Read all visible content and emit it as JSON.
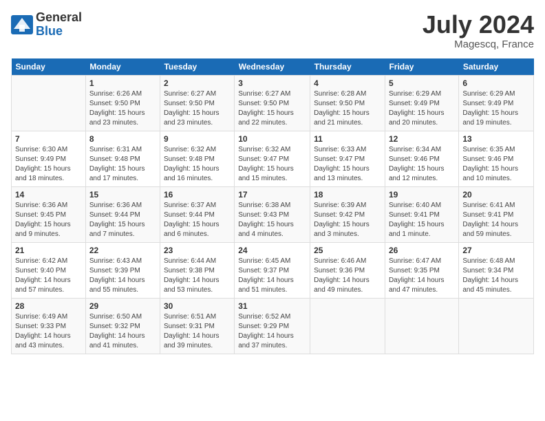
{
  "logo": {
    "general": "General",
    "blue": "Blue"
  },
  "title": "July 2024",
  "location": "Magescq, France",
  "days_header": [
    "Sunday",
    "Monday",
    "Tuesday",
    "Wednesday",
    "Thursday",
    "Friday",
    "Saturday"
  ],
  "weeks": [
    [
      {
        "day": "",
        "sunrise": "",
        "sunset": "",
        "daylight": ""
      },
      {
        "day": "1",
        "sunrise": "Sunrise: 6:26 AM",
        "sunset": "Sunset: 9:50 PM",
        "daylight": "Daylight: 15 hours and 23 minutes."
      },
      {
        "day": "2",
        "sunrise": "Sunrise: 6:27 AM",
        "sunset": "Sunset: 9:50 PM",
        "daylight": "Daylight: 15 hours and 23 minutes."
      },
      {
        "day": "3",
        "sunrise": "Sunrise: 6:27 AM",
        "sunset": "Sunset: 9:50 PM",
        "daylight": "Daylight: 15 hours and 22 minutes."
      },
      {
        "day": "4",
        "sunrise": "Sunrise: 6:28 AM",
        "sunset": "Sunset: 9:50 PM",
        "daylight": "Daylight: 15 hours and 21 minutes."
      },
      {
        "day": "5",
        "sunrise": "Sunrise: 6:29 AM",
        "sunset": "Sunset: 9:49 PM",
        "daylight": "Daylight: 15 hours and 20 minutes."
      },
      {
        "day": "6",
        "sunrise": "Sunrise: 6:29 AM",
        "sunset": "Sunset: 9:49 PM",
        "daylight": "Daylight: 15 hours and 19 minutes."
      }
    ],
    [
      {
        "day": "7",
        "sunrise": "Sunrise: 6:30 AM",
        "sunset": "Sunset: 9:49 PM",
        "daylight": "Daylight: 15 hours and 18 minutes."
      },
      {
        "day": "8",
        "sunrise": "Sunrise: 6:31 AM",
        "sunset": "Sunset: 9:48 PM",
        "daylight": "Daylight: 15 hours and 17 minutes."
      },
      {
        "day": "9",
        "sunrise": "Sunrise: 6:32 AM",
        "sunset": "Sunset: 9:48 PM",
        "daylight": "Daylight: 15 hours and 16 minutes."
      },
      {
        "day": "10",
        "sunrise": "Sunrise: 6:32 AM",
        "sunset": "Sunset: 9:47 PM",
        "daylight": "Daylight: 15 hours and 15 minutes."
      },
      {
        "day": "11",
        "sunrise": "Sunrise: 6:33 AM",
        "sunset": "Sunset: 9:47 PM",
        "daylight": "Daylight: 15 hours and 13 minutes."
      },
      {
        "day": "12",
        "sunrise": "Sunrise: 6:34 AM",
        "sunset": "Sunset: 9:46 PM",
        "daylight": "Daylight: 15 hours and 12 minutes."
      },
      {
        "day": "13",
        "sunrise": "Sunrise: 6:35 AM",
        "sunset": "Sunset: 9:46 PM",
        "daylight": "Daylight: 15 hours and 10 minutes."
      }
    ],
    [
      {
        "day": "14",
        "sunrise": "Sunrise: 6:36 AM",
        "sunset": "Sunset: 9:45 PM",
        "daylight": "Daylight: 15 hours and 9 minutes."
      },
      {
        "day": "15",
        "sunrise": "Sunrise: 6:36 AM",
        "sunset": "Sunset: 9:44 PM",
        "daylight": "Daylight: 15 hours and 7 minutes."
      },
      {
        "day": "16",
        "sunrise": "Sunrise: 6:37 AM",
        "sunset": "Sunset: 9:44 PM",
        "daylight": "Daylight: 15 hours and 6 minutes."
      },
      {
        "day": "17",
        "sunrise": "Sunrise: 6:38 AM",
        "sunset": "Sunset: 9:43 PM",
        "daylight": "Daylight: 15 hours and 4 minutes."
      },
      {
        "day": "18",
        "sunrise": "Sunrise: 6:39 AM",
        "sunset": "Sunset: 9:42 PM",
        "daylight": "Daylight: 15 hours and 3 minutes."
      },
      {
        "day": "19",
        "sunrise": "Sunrise: 6:40 AM",
        "sunset": "Sunset: 9:41 PM",
        "daylight": "Daylight: 15 hours and 1 minute."
      },
      {
        "day": "20",
        "sunrise": "Sunrise: 6:41 AM",
        "sunset": "Sunset: 9:41 PM",
        "daylight": "Daylight: 14 hours and 59 minutes."
      }
    ],
    [
      {
        "day": "21",
        "sunrise": "Sunrise: 6:42 AM",
        "sunset": "Sunset: 9:40 PM",
        "daylight": "Daylight: 14 hours and 57 minutes."
      },
      {
        "day": "22",
        "sunrise": "Sunrise: 6:43 AM",
        "sunset": "Sunset: 9:39 PM",
        "daylight": "Daylight: 14 hours and 55 minutes."
      },
      {
        "day": "23",
        "sunrise": "Sunrise: 6:44 AM",
        "sunset": "Sunset: 9:38 PM",
        "daylight": "Daylight: 14 hours and 53 minutes."
      },
      {
        "day": "24",
        "sunrise": "Sunrise: 6:45 AM",
        "sunset": "Sunset: 9:37 PM",
        "daylight": "Daylight: 14 hours and 51 minutes."
      },
      {
        "day": "25",
        "sunrise": "Sunrise: 6:46 AM",
        "sunset": "Sunset: 9:36 PM",
        "daylight": "Daylight: 14 hours and 49 minutes."
      },
      {
        "day": "26",
        "sunrise": "Sunrise: 6:47 AM",
        "sunset": "Sunset: 9:35 PM",
        "daylight": "Daylight: 14 hours and 47 minutes."
      },
      {
        "day": "27",
        "sunrise": "Sunrise: 6:48 AM",
        "sunset": "Sunset: 9:34 PM",
        "daylight": "Daylight: 14 hours and 45 minutes."
      }
    ],
    [
      {
        "day": "28",
        "sunrise": "Sunrise: 6:49 AM",
        "sunset": "Sunset: 9:33 PM",
        "daylight": "Daylight: 14 hours and 43 minutes."
      },
      {
        "day": "29",
        "sunrise": "Sunrise: 6:50 AM",
        "sunset": "Sunset: 9:32 PM",
        "daylight": "Daylight: 14 hours and 41 minutes."
      },
      {
        "day": "30",
        "sunrise": "Sunrise: 6:51 AM",
        "sunset": "Sunset: 9:31 PM",
        "daylight": "Daylight: 14 hours and 39 minutes."
      },
      {
        "day": "31",
        "sunrise": "Sunrise: 6:52 AM",
        "sunset": "Sunset: 9:29 PM",
        "daylight": "Daylight: 14 hours and 37 minutes."
      },
      {
        "day": "",
        "sunrise": "",
        "sunset": "",
        "daylight": ""
      },
      {
        "day": "",
        "sunrise": "",
        "sunset": "",
        "daylight": ""
      },
      {
        "day": "",
        "sunrise": "",
        "sunset": "",
        "daylight": ""
      }
    ]
  ]
}
